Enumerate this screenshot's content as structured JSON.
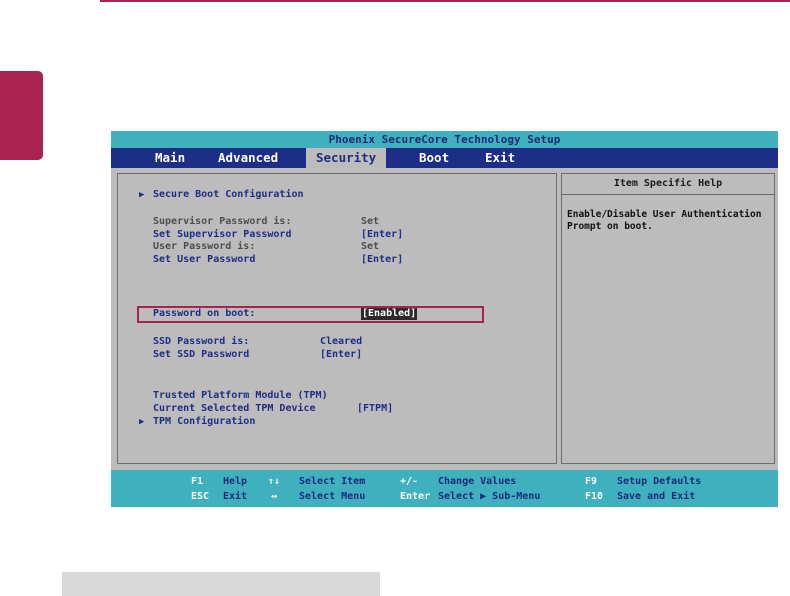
{
  "title": "Phoenix SecureCore Technology Setup",
  "menu": [
    {
      "label": "Main"
    },
    {
      "label": "Advanced"
    },
    {
      "label": "Security"
    },
    {
      "label": "Boot"
    },
    {
      "label": "Exit"
    }
  ],
  "active_menu": "Security",
  "items": {
    "secure_boot": "Secure Boot Configuration",
    "supervisor_pw_status": {
      "label": "Supervisor Password is:",
      "value": "Set"
    },
    "set_supervisor_pw": {
      "label": "Set Supervisor Password",
      "value": "[Enter]"
    },
    "user_pw_status": {
      "label": "User Password is:",
      "value": "Set"
    },
    "set_user_pw": {
      "label": "Set User Password",
      "value": "[Enter]"
    },
    "password_on_boot": {
      "label": "Password on boot:",
      "value": "[Enabled]"
    },
    "ssd_pw_status": {
      "label": "SSD Password is:",
      "value": "Cleared"
    },
    "set_ssd_pw": {
      "label": "Set SSD Password",
      "value": "[Enter]"
    },
    "tpm_heading": "Trusted Platform Module (TPM)",
    "tpm_device": {
      "label": "Current Selected TPM Device",
      "value": "[FTPM]"
    },
    "tpm_config": "TPM Configuration"
  },
  "help": {
    "header": "Item Specific Help",
    "text": "Enable/Disable User Authentication\nPrompt on boot."
  },
  "status_bar": {
    "row1": [
      {
        "key": "F1",
        "desc": "Help"
      },
      {
        "key": "↑↓",
        "desc": "Select Item"
      },
      {
        "key": "+/-",
        "desc": "Change Values"
      },
      {
        "key": "F9",
        "desc": "Setup Defaults"
      }
    ],
    "row2": [
      {
        "key": "ESC",
        "desc": "Exit"
      },
      {
        "key": "↔",
        "desc": "Select Menu"
      },
      {
        "key": "Enter",
        "desc": "Select ▶ Sub-Menu"
      },
      {
        "key": "F10",
        "desc": "Save and Exit"
      }
    ]
  },
  "colors": {
    "accent": "#a8234f",
    "menu_bar": "#1d2e86",
    "title_bar": "#3fb0bd",
    "panel_bg": "#bcbcbc"
  }
}
